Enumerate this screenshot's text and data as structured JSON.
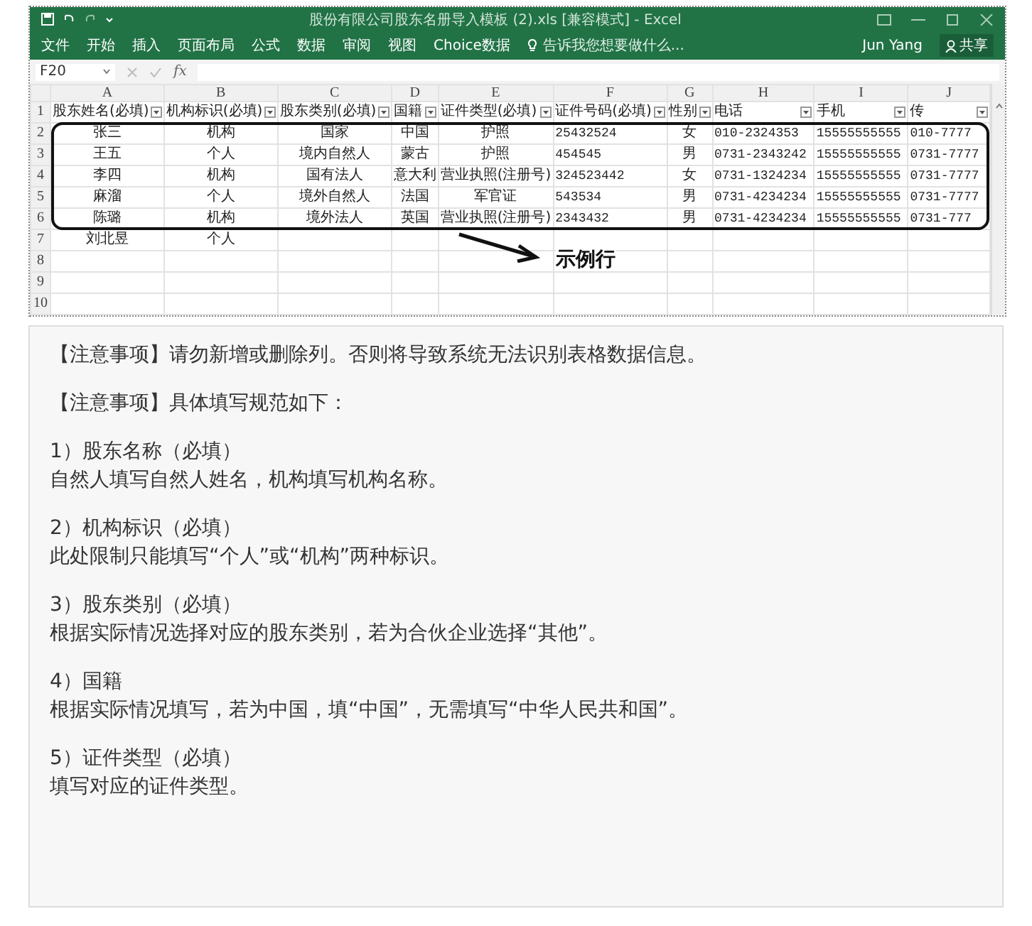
{
  "excel": {
    "title": "股份有限公司股东名册导入模板 (2).xls  [兼容模式] - Excel",
    "ribbon_tabs": [
      "文件",
      "开始",
      "插入",
      "页面布局",
      "公式",
      "数据",
      "审阅",
      "视图",
      "Choice数据"
    ],
    "tell_me": "告诉我您想要做什么...",
    "user": "Jun Yang",
    "share": "共享",
    "name_box": "F20",
    "header_row_number": "1",
    "fx": "fx",
    "columns": [
      {
        "letter": "A",
        "header": "股东姓名(必填)"
      },
      {
        "letter": "B",
        "header": "机构标识(必填)"
      },
      {
        "letter": "C",
        "header": "股东类别(必填)"
      },
      {
        "letter": "D",
        "header": "国籍"
      },
      {
        "letter": "E",
        "header": "证件类型(必填)"
      },
      {
        "letter": "F",
        "header": "证件号码(必填)"
      },
      {
        "letter": "G",
        "header": "性别"
      },
      {
        "letter": "H",
        "header": "电话"
      },
      {
        "letter": "I",
        "header": "手机"
      },
      {
        "letter": "J",
        "header": "传"
      }
    ],
    "rows": [
      {
        "number": "2",
        "cells": [
          "张三",
          "机构",
          "国家",
          "中国",
          "护照",
          "25432524",
          "女",
          "010-2324353",
          "15555555555",
          "010-7777"
        ]
      },
      {
        "number": "3",
        "cells": [
          "王五",
          "个人",
          "境内自然人",
          "蒙古",
          "护照",
          "454545",
          "男",
          "0731-2343242",
          "15555555555",
          "0731-7777"
        ]
      },
      {
        "number": "4",
        "cells": [
          "李四",
          "机构",
          "国有法人",
          "意大利",
          "营业执照(注册号)",
          "324523442",
          "女",
          "0731-1324234",
          "15555555555",
          "0731-7777"
        ]
      },
      {
        "number": "5",
        "cells": [
          "麻溜",
          "个人",
          "境外自然人",
          "法国",
          "军官证",
          "543534",
          "男",
          "0731-4234234",
          "15555555555",
          "0731-7777"
        ]
      },
      {
        "number": "6",
        "cells": [
          "陈璐",
          "机构",
          "境外法人",
          "英国",
          "营业执照(注册号)",
          "2343432",
          "男",
          "0731-4234234",
          "15555555555",
          "0731-777"
        ]
      },
      {
        "number": "7",
        "cells": [
          "刘北昱",
          "个人"
        ]
      },
      {
        "number": "8",
        "cells": []
      },
      {
        "number": "9",
        "cells": []
      },
      {
        "number": "10",
        "cells": []
      }
    ],
    "example_label": "示例行"
  },
  "notes": [
    {
      "lines": [
        "【注意事项】请勿新增或删除列。否则将导致系统无法识别表格数据信息。"
      ]
    },
    {
      "lines": [
        "【注意事项】具体填写规范如下："
      ]
    },
    {
      "lines": [
        "1）股东名称（必填）",
        "自然人填写自然人姓名，机构填写机构名称。"
      ]
    },
    {
      "lines": [
        "2）机构标识（必填）",
        "此处限制只能填写“个人”或“机构”两种标识。"
      ]
    },
    {
      "lines": [
        "3）股东类别（必填）",
        "根据实际情况选择对应的股东类别，若为合伙企业选择“其他”。"
      ]
    },
    {
      "lines": [
        "4）国籍",
        "根据实际情况填写，若为中国，填“中国”，无需填写“中华人民共和国”。"
      ]
    },
    {
      "lines": [
        "5）证件类型（必填）",
        "填写对应的证件类型。"
      ]
    }
  ]
}
